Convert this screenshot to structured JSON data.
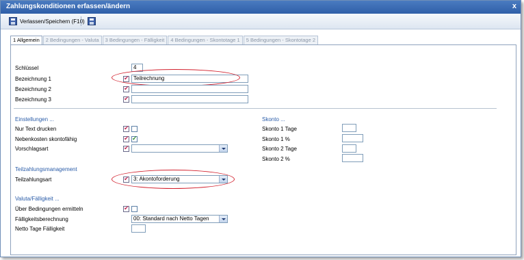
{
  "window": {
    "title": "Zahlungskonditionen erfassen/ändern",
    "close_glyph": "x"
  },
  "toolbar": {
    "save_exit_label": "Verlassen/Speichern (F10)"
  },
  "tabs": [
    {
      "label": "1 Allgemein"
    },
    {
      "label": "2 Bedingungen - Valuta"
    },
    {
      "label": "3 Bedingungen - Fälligkeit"
    },
    {
      "label": "4 Bedingungen - Skontotage 1"
    },
    {
      "label": "5 Bedingungen - Skontotage 2"
    }
  ],
  "general": {
    "schluessel_label": "Schlüssel",
    "schluessel_value": "4",
    "bezeichnung1_label": "Bezeichnung 1",
    "bezeichnung1_value": "Teilrechnung",
    "bezeichnung2_label": "Bezeichnung 2",
    "bezeichnung2_value": "",
    "bezeichnung3_label": "Bezeichnung 3",
    "bezeichnung3_value": ""
  },
  "einstellungen": {
    "heading": "Einstellungen ...",
    "nur_text_label": "Nur Text drucken",
    "nur_text_checked": false,
    "nebenkosten_label": "Nebenkosten skontofähig",
    "nebenkosten_checked": true,
    "vorschlagsart_label": "Vorschlagsart",
    "vorschlagsart_value": ""
  },
  "skonto": {
    "heading": "Skonto ...",
    "tage1_label": "Skonto 1 Tage",
    "prozent1_label": "Skonto 1 %",
    "tage2_label": "Skonto 2 Tage",
    "prozent2_label": "Skonto 2 %"
  },
  "teilzahlung": {
    "heading": "Teilzahlungsmanagement",
    "art_label": "Teilzahlungsart",
    "art_value": "3: Akontoforderung"
  },
  "valuta": {
    "heading": "Valuta/Fälligkeit ...",
    "ermitteln_label": "Über Bedingungen ermitteln",
    "ermitteln_checked": false,
    "berechnung_label": "Fälligkeitsberechnung",
    "berechnung_value": "00: Standard nach Netto Tagen",
    "netto_tage_label": "Netto Tage Fälligkeit",
    "netto_tage_value": ""
  },
  "colors": {
    "accent_blue": "#2a5ca8",
    "highlight_red": "#d21f2c",
    "titlebar": "#3a6ab4"
  }
}
